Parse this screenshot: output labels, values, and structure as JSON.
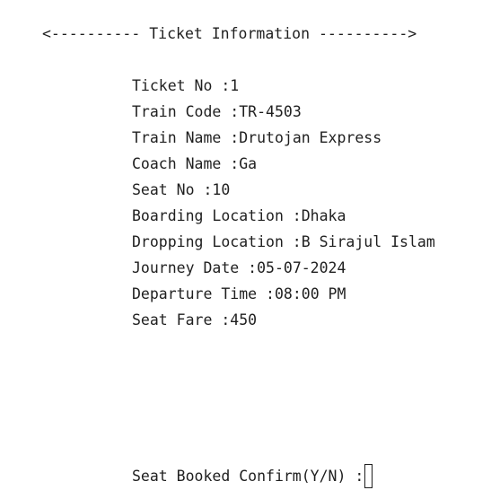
{
  "header": "<---------- Ticket Information ---------->",
  "fields": [
    {
      "label": "Ticket No :",
      "value": "1"
    },
    {
      "label": "Train Code :",
      "value": "TR-4503"
    },
    {
      "label": "Train Name :",
      "value": "Drutojan Express"
    },
    {
      "label": "Coach Name :",
      "value": "Ga"
    },
    {
      "label": "Seat No :",
      "value": "10"
    },
    {
      "label": "Boarding Location :",
      "value": "Dhaka"
    },
    {
      "label": "Dropping Location :",
      "value": "B Sirajul Islam"
    },
    {
      "label": "Journey Date :",
      "value": "05-07-2024"
    },
    {
      "label": "Departure Time :",
      "value": "08:00 PM"
    },
    {
      "label": "Seat Fare :",
      "value": "450"
    }
  ],
  "prompt": {
    "text": "Seat Booked Confirm(Y/N) :",
    "input_value": ""
  }
}
